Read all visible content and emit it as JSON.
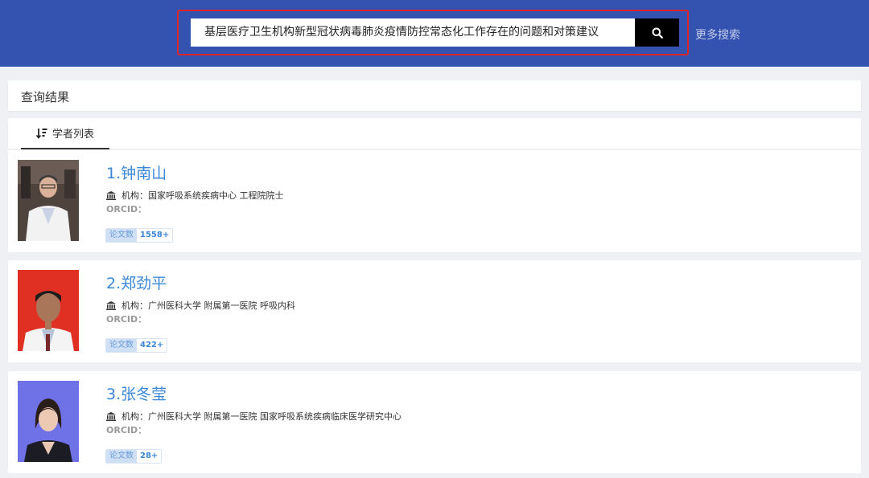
{
  "search": {
    "query": "基层医疗卫生机构新型冠状病毒肺炎疫情防控常态化工作存在的问题和对策建议",
    "button_icon": "search-icon",
    "more_label": "更多搜索"
  },
  "results": {
    "title": "查询结果",
    "tab_label": "学者列表",
    "tab_icon": "sort-desc-icon"
  },
  "scholars": [
    {
      "name": "1.钟南山",
      "institution": "机构：国家呼吸系统疾病中心 工程院院士",
      "orcid_label": "ORCID：",
      "papers_label": "论文数",
      "papers_count": "1558+",
      "photo_bg": "#5a4a44"
    },
    {
      "name": "2.郑劲平",
      "institution": "机构：广州医科大学 附属第一医院 呼吸内科",
      "orcid_label": "ORCID：",
      "papers_label": "论文数",
      "papers_count": "422+",
      "photo_bg": "#e03024"
    },
    {
      "name": "3.张冬莹",
      "institution": "机构：广州医科大学 附属第一医院 国家呼吸系统疾病临床医学研究中心",
      "orcid_label": "ORCID：",
      "papers_label": "论文数",
      "papers_count": "28+",
      "photo_bg": "#6f72e6"
    }
  ],
  "colors": {
    "header_bg": "#3452b0",
    "highlight_border": "#d9262a",
    "link": "#3a87d8"
  }
}
